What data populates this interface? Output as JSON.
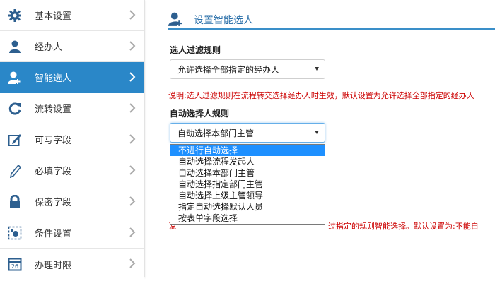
{
  "sidebar": {
    "items": [
      {
        "label": "基本设置",
        "icon": "gear-icon"
      },
      {
        "label": "经办人",
        "icon": "user-icon"
      },
      {
        "label": "智能选人",
        "icon": "user-add-icon",
        "active": true
      },
      {
        "label": "流转设置",
        "icon": "refresh-icon"
      },
      {
        "label": "可写字段",
        "icon": "edit-icon"
      },
      {
        "label": "必填字段",
        "icon": "pencil-icon"
      },
      {
        "label": "保密字段",
        "icon": "lock-icon"
      },
      {
        "label": "条件设置",
        "icon": "condition-icon"
      },
      {
        "label": "办理时限",
        "icon": "calendar-icon"
      }
    ]
  },
  "header": {
    "title": "设置智能选人",
    "icon": "user-add-icon"
  },
  "filter_rule": {
    "label": "选人过滤规则",
    "selected": "允许选择全部指定的经办人",
    "note": "说明:选人过滤规则在流程转交选择经办人时生效，默认设置为允许选择全部指定的经办人"
  },
  "auto_rule": {
    "label": "自动选择人规则",
    "selected": "自动选择本部门主管",
    "options": [
      "不进行自动选择",
      "自动选择流程发起人",
      "自动选择本部门主管",
      "自动选择指定部门主管",
      "自动选择上级主管领导",
      "指定自动选择默认人员",
      "按表单字段选择"
    ],
    "highlighted_index": 0,
    "note_left": "说",
    "note_right": "过指定的规则智能选择。默认设置为:不能自"
  },
  "colors": {
    "accent": "#2a87c8",
    "note": "#cc0000",
    "highlight": "#1e90ff"
  }
}
